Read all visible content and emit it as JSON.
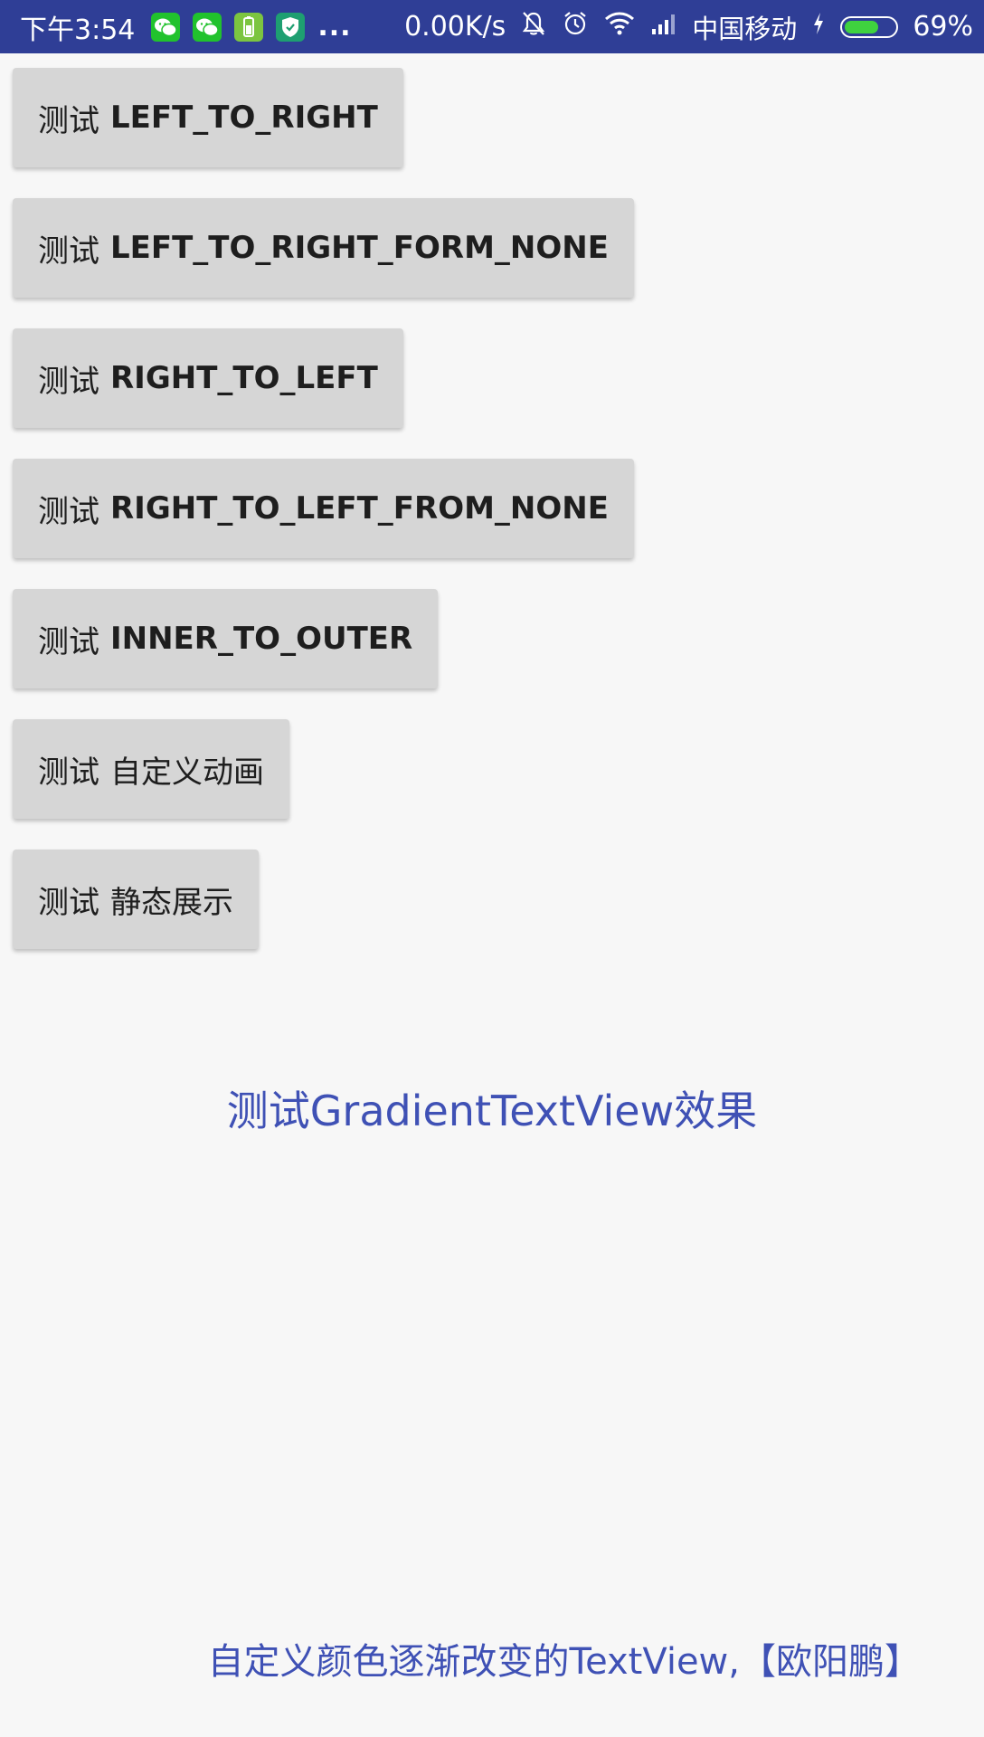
{
  "status_bar": {
    "time": "下午3:54",
    "more": "...",
    "speed": "0.00K/s",
    "carrier": "中国移动",
    "battery": "69%",
    "battery_level": 0.69,
    "icons": [
      "wechat-icon",
      "wechat-icon",
      "battery-app-icon",
      "shield-icon",
      "mute-bell-icon",
      "alarm-icon",
      "wifi-icon",
      "signal-icon",
      "charging-icon",
      "battery-icon"
    ]
  },
  "buttons": [
    {
      "prefix": "测试",
      "label": "LEFT_TO_RIGHT"
    },
    {
      "prefix": "测试",
      "label": "LEFT_TO_RIGHT_FORM_NONE"
    },
    {
      "prefix": "测试",
      "label": "RIGHT_TO_LEFT"
    },
    {
      "prefix": "测试",
      "label": "RIGHT_TO_LEFT_FROM_NONE"
    },
    {
      "prefix": "测试",
      "label": "INNER_TO_OUTER"
    },
    {
      "prefix": "测试",
      "label": "自定义动画"
    },
    {
      "prefix": "测试",
      "label": "静态展示"
    }
  ],
  "gradient_text": "测试GradientTextView效果",
  "footer_text": "自定义颜色逐渐改变的TextView,【欧阳鹏】",
  "colors": {
    "status_bar": "#2f3e96",
    "accent": "#3f51b5",
    "button_bg": "#d6d6d6",
    "page_bg": "#f7f7f7"
  }
}
